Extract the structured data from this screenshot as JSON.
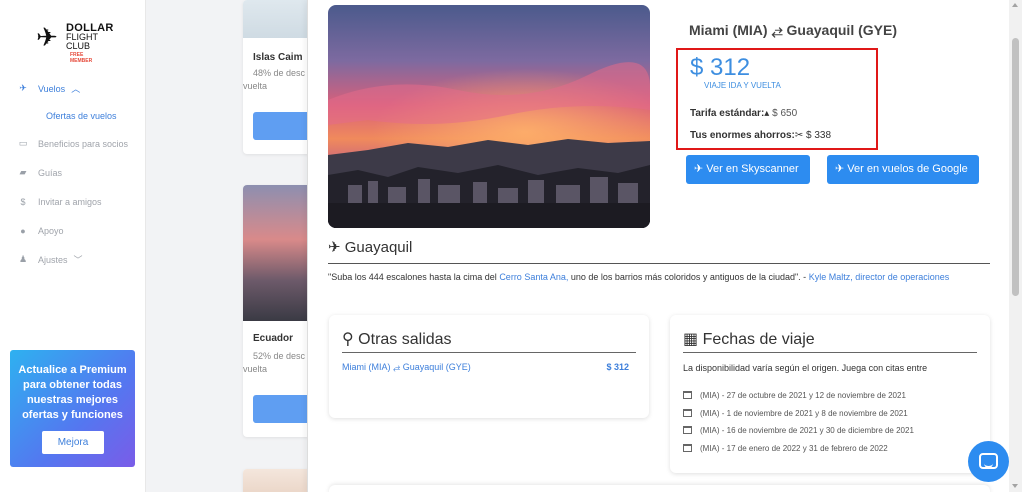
{
  "brand": {
    "line1": "DOLLAR",
    "line2": "FLIGHT",
    "line3": "CLUB",
    "tier": "FREE MEMBER"
  },
  "sidebar": {
    "items": [
      {
        "label": "Vuelos",
        "icon": "plane-icon",
        "active": true
      },
      {
        "label": "Beneficios para socios",
        "icon": "ticket-icon"
      },
      {
        "label": "Guías",
        "icon": "book-icon"
      },
      {
        "label": "Invitar a amigos",
        "icon": "dollar-icon"
      },
      {
        "label": "Apoyo",
        "icon": "help-icon"
      },
      {
        "label": "Ajustes",
        "icon": "user-icon"
      }
    ],
    "sub_item": "Ofertas de vuelos",
    "premium_text": "Actualice a Premium para obtener todas nuestras mejores ofertas y funciones",
    "premium_button": "Mejora"
  },
  "background_cards": [
    {
      "title": "Islas Caim",
      "sub1": "48% de desc",
      "sub2": "vuelta"
    },
    {
      "title": "Ecuador",
      "sub1": "52% de desc",
      "sub2": "vuelta"
    }
  ],
  "deal": {
    "route": "Miami (MIA) ⥄ Guayaquil (GYE)",
    "price": "$ 312",
    "price_label": "VIAJE IDA Y VUELTA",
    "standard_label": "Tarifa estándar:",
    "standard_value": "$ 650",
    "savings_label": "Tus enormes ahorros:",
    "savings_value": "$ 338",
    "skyscanner_button": "Ver en Skyscanner",
    "google_button": "Ver en vuelos de Google"
  },
  "destination": {
    "name": "Guayaquil",
    "quote_start": "\"Suba los 444 escalones hasta la cima del ",
    "quote_link": "Cerro Santa Ana,",
    "quote_mid": " uno de los barrios más coloridos y antiguos de la ciudad\". - ",
    "quote_author": "Kyle Maltz, director de operaciones"
  },
  "other_departures": {
    "title": "Otras salidas",
    "rows": [
      {
        "route": "Miami (MIA) ⥄ Guayaquil (GYE)",
        "price": "$ 312"
      }
    ]
  },
  "travel_dates": {
    "title": "Fechas de viaje",
    "description": "La disponibilidad varía según el origen. Juega con citas entre",
    "dates": [
      "(MIA) - 27 de octubre de 2021 y 12 de noviembre de 2021",
      "(MIA) - 1 de noviembre de 2021 y 8 de noviembre de 2021",
      "(MIA) - 16 de noviembre de 2021 y 30 de diciembre de 2021",
      "(MIA) - 17 de enero de 2022 y 31 de febrero de 2022"
    ]
  },
  "colors": {
    "accent": "#2d8cf0",
    "link": "#3d7fdb",
    "highlight_border": "#e01818"
  }
}
